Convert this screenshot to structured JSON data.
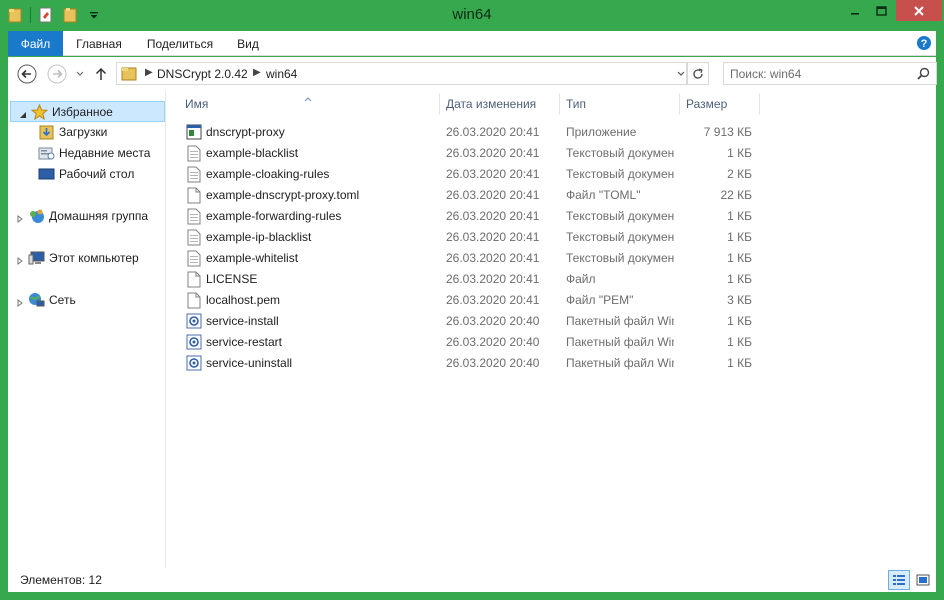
{
  "window": {
    "title": "win64",
    "accent": "#36a84d",
    "close_color": "#c7504d"
  },
  "quick_access": [
    "folder-icon",
    "properties-icon",
    "new-folder-icon",
    "customize-dropdown-icon"
  ],
  "ribbon": {
    "tabs": [
      {
        "label": "Файл",
        "active": true
      },
      {
        "label": "Главная",
        "active": false
      },
      {
        "label": "Поделиться",
        "active": false
      },
      {
        "label": "Вид",
        "active": false
      }
    ],
    "help_icon": "help-icon"
  },
  "address": {
    "crumbs": [
      "DNSCrypt 2.0.42",
      "win64"
    ]
  },
  "search": {
    "placeholder": "Поиск: win64"
  },
  "nav_pane": {
    "favorites": {
      "label": "Избранное",
      "expanded": true,
      "selected": true
    },
    "favorite_items": [
      {
        "label": "Загрузки",
        "icon": "downloads-icon"
      },
      {
        "label": "Недавние места",
        "icon": "recent-places-icon"
      },
      {
        "label": "Рабочий стол",
        "icon": "desktop-icon"
      }
    ],
    "groups": [
      {
        "label": "Домашняя группа",
        "icon": "homegroup-icon"
      },
      {
        "label": "Этот компьютер",
        "icon": "computer-icon"
      },
      {
        "label": "Сеть",
        "icon": "network-icon"
      }
    ]
  },
  "columns": {
    "name": "Имя",
    "date": "Дата изменения",
    "type": "Тип",
    "size": "Размер"
  },
  "files": [
    {
      "name": "dnscrypt-proxy",
      "date": "26.03.2020 20:41",
      "type": "Приложение",
      "size": "7 913 КБ",
      "icon": "exe"
    },
    {
      "name": "example-blacklist",
      "date": "26.03.2020 20:41",
      "type": "Текстовый документ",
      "size": "1 КБ",
      "icon": "txt"
    },
    {
      "name": "example-cloaking-rules",
      "date": "26.03.2020 20:41",
      "type": "Текстовый документ",
      "size": "2 КБ",
      "icon": "txt"
    },
    {
      "name": "example-dnscrypt-proxy.toml",
      "date": "26.03.2020 20:41",
      "type": "Файл \"TOML\"",
      "size": "22 КБ",
      "icon": "file"
    },
    {
      "name": "example-forwarding-rules",
      "date": "26.03.2020 20:41",
      "type": "Текстовый документ",
      "size": "1 КБ",
      "icon": "txt"
    },
    {
      "name": "example-ip-blacklist",
      "date": "26.03.2020 20:41",
      "type": "Текстовый документ",
      "size": "1 КБ",
      "icon": "txt"
    },
    {
      "name": "example-whitelist",
      "date": "26.03.2020 20:41",
      "type": "Текстовый документ",
      "size": "1 КБ",
      "icon": "txt"
    },
    {
      "name": "LICENSE",
      "date": "26.03.2020 20:41",
      "type": "Файл",
      "size": "1 КБ",
      "icon": "file"
    },
    {
      "name": "localhost.pem",
      "date": "26.03.2020 20:41",
      "type": "Файл \"PEM\"",
      "size": "3 КБ",
      "icon": "file"
    },
    {
      "name": "service-install",
      "date": "26.03.2020 20:40",
      "type": "Пакетный файл Windows",
      "size": "1 КБ",
      "icon": "bat"
    },
    {
      "name": "service-restart",
      "date": "26.03.2020 20:40",
      "type": "Пакетный файл Windows",
      "size": "1 КБ",
      "icon": "bat"
    },
    {
      "name": "service-uninstall",
      "date": "26.03.2020 20:40",
      "type": "Пакетный файл Windows",
      "size": "1 КБ",
      "icon": "bat"
    }
  ],
  "status": {
    "items_text": "Элементов: 12"
  }
}
